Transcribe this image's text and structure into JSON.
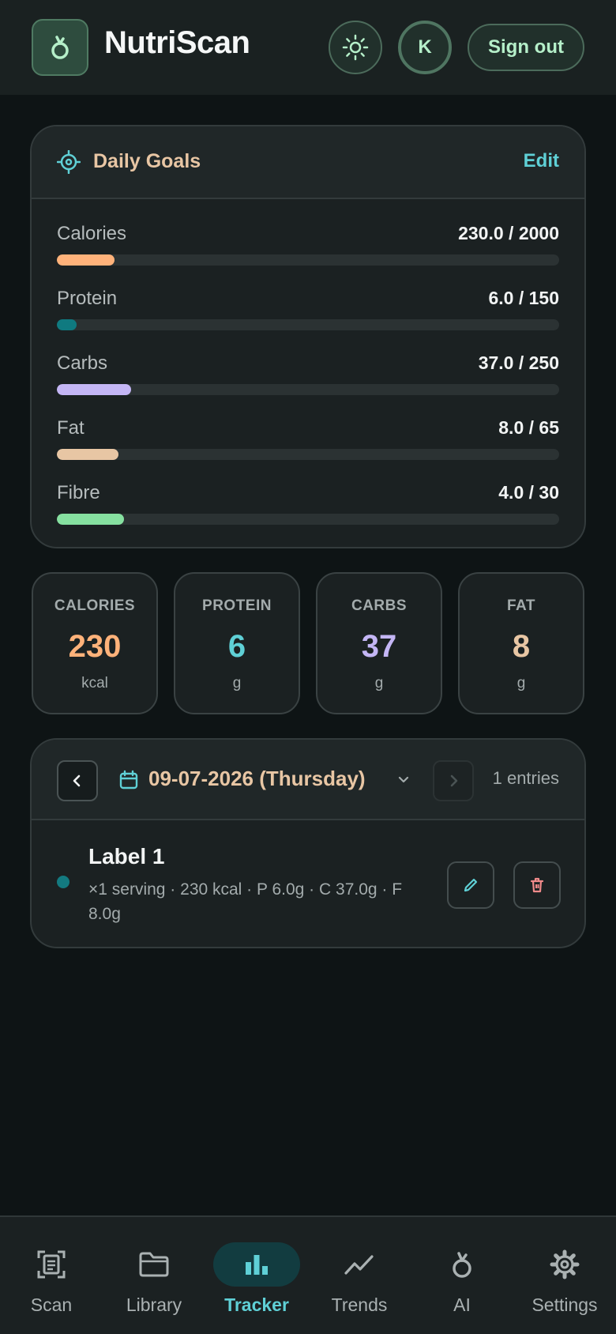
{
  "header": {
    "app_name": "NutriScan",
    "avatar_initial": "K",
    "signout_label": "Sign out"
  },
  "colors": {
    "accent_teal": "#5fd0d6",
    "accent_peach": "#e8c6a4",
    "calories": "#ffb27a",
    "protein": "#0f7a80",
    "carbs": "#c4b6f5",
    "fat": "#e8c6a4",
    "fibre": "#86e0a0"
  },
  "goals": {
    "title": "Daily Goals",
    "edit_label": "Edit",
    "items": [
      {
        "label": "Calories",
        "value": "230.0 / 2000",
        "progress": 0.115
      },
      {
        "label": "Protein",
        "value": "6.0 / 150",
        "progress": 0.04
      },
      {
        "label": "Carbs",
        "value": "37.0 / 250",
        "progress": 0.148
      },
      {
        "label": "Fat",
        "value": "8.0 / 65",
        "progress": 0.123
      },
      {
        "label": "Fibre",
        "value": "4.0 / 30",
        "progress": 0.133
      }
    ]
  },
  "stats": [
    {
      "label": "CALORIES",
      "value": "230",
      "unit": "kcal"
    },
    {
      "label": "PROTEIN",
      "value": "6",
      "unit": "g"
    },
    {
      "label": "CARBS",
      "value": "37",
      "unit": "g"
    },
    {
      "label": "FAT",
      "value": "8",
      "unit": "g"
    }
  ],
  "log": {
    "date": "09-07-2026 (Thursday)",
    "entries_count": "1 entries",
    "entries": [
      {
        "name": "Label 1",
        "meta": "×1 serving · 230 kcal · P 6.0g · C 37.0g · F 8.0g"
      }
    ]
  },
  "nav": {
    "items": [
      {
        "label": "Scan",
        "icon": "scan-icon"
      },
      {
        "label": "Library",
        "icon": "folder-icon"
      },
      {
        "label": "Tracker",
        "icon": "bar-chart-icon",
        "active": true
      },
      {
        "label": "Trends",
        "icon": "trend-line-icon"
      },
      {
        "label": "AI",
        "icon": "apple-icon"
      },
      {
        "label": "Settings",
        "icon": "gear-icon"
      }
    ]
  }
}
